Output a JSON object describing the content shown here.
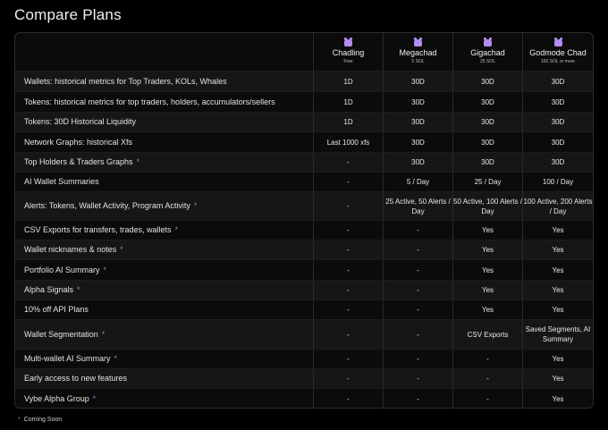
{
  "page": {
    "title": "Compare Plans",
    "footnote_marker": "*",
    "footnote_text": "Coming Soon"
  },
  "colors": {
    "background": "#000000",
    "row_alt": "#161616",
    "star_accent": "#8f7bd6",
    "plan_icon": "#b48cf0"
  },
  "plans": [
    {
      "name": "Chadling",
      "price": "Free",
      "icon": "pepe-frog-icon"
    },
    {
      "name": "Megachad",
      "price": "5 SOL",
      "icon": "pepe-frog-icon"
    },
    {
      "name": "Gigachad",
      "price": "25 SOL",
      "icon": "pepe-frog-icon"
    },
    {
      "name": "Godmode Chad",
      "price": "100 SOL or more",
      "icon": "pepe-frog-icon"
    }
  ],
  "rows": [
    {
      "feature": "Wallets: historical metrics for Top Traders, KOLs, Whales",
      "coming_soon": false,
      "values": [
        "1D",
        "30D",
        "30D",
        "30D"
      ]
    },
    {
      "feature": "Tokens: historical metrics for top traders, holders, accumulators/sellers",
      "coming_soon": false,
      "values": [
        "1D",
        "30D",
        "30D",
        "30D"
      ]
    },
    {
      "feature": "Tokens: 30D Historical Liquidity",
      "coming_soon": false,
      "values": [
        "1D",
        "30D",
        "30D",
        "30D"
      ]
    },
    {
      "feature": "Network Graphs: historical Xfs",
      "coming_soon": false,
      "values": [
        "Last 1000 xfs",
        "30D",
        "30D",
        "30D"
      ]
    },
    {
      "feature": "Top Holders & Traders Graphs",
      "coming_soon": true,
      "values": [
        "-",
        "30D",
        "30D",
        "30D"
      ]
    },
    {
      "feature": "AI Wallet Summaries",
      "coming_soon": false,
      "values": [
        "-",
        "5 / Day",
        "25 / Day",
        "100 / Day"
      ]
    },
    {
      "feature": "Alerts: Tokens, Wallet Activity, Program Activity",
      "coming_soon": true,
      "values": [
        "-",
        "25 Active, 50 Alerts / Day",
        "50 Active, 100 Alerts / Day",
        "100 Active, 200 Alerts / Day"
      ]
    },
    {
      "feature": "CSV Exports for transfers, trades, wallets",
      "coming_soon": true,
      "values": [
        "-",
        "-",
        "Yes",
        "Yes"
      ]
    },
    {
      "feature": "Wallet nicknames & notes",
      "coming_soon": true,
      "values": [
        "-",
        "-",
        "Yes",
        "Yes"
      ]
    },
    {
      "feature": "Portfolio AI Summary",
      "coming_soon": true,
      "values": [
        "-",
        "-",
        "Yes",
        "Yes"
      ]
    },
    {
      "feature": "Alpha Signals",
      "coming_soon": true,
      "values": [
        "-",
        "-",
        "Yes",
        "Yes"
      ]
    },
    {
      "feature": "10% off API Plans",
      "coming_soon": false,
      "values": [
        "-",
        "-",
        "Yes",
        "Yes"
      ]
    },
    {
      "feature": "Wallet Segmentation",
      "coming_soon": true,
      "values": [
        "-",
        "-",
        "CSV Exports",
        "Saved Segments, AI Summary"
      ]
    },
    {
      "feature": "Multi-wallet AI Summary",
      "coming_soon": true,
      "values": [
        "-",
        "-",
        "-",
        "Yes"
      ]
    },
    {
      "feature": "Early access to new features",
      "coming_soon": false,
      "values": [
        "-",
        "-",
        "-",
        "Yes"
      ]
    },
    {
      "feature": "Vybe Alpha Group",
      "coming_soon": true,
      "values": [
        "-",
        "-",
        "-",
        "Yes"
      ]
    }
  ]
}
